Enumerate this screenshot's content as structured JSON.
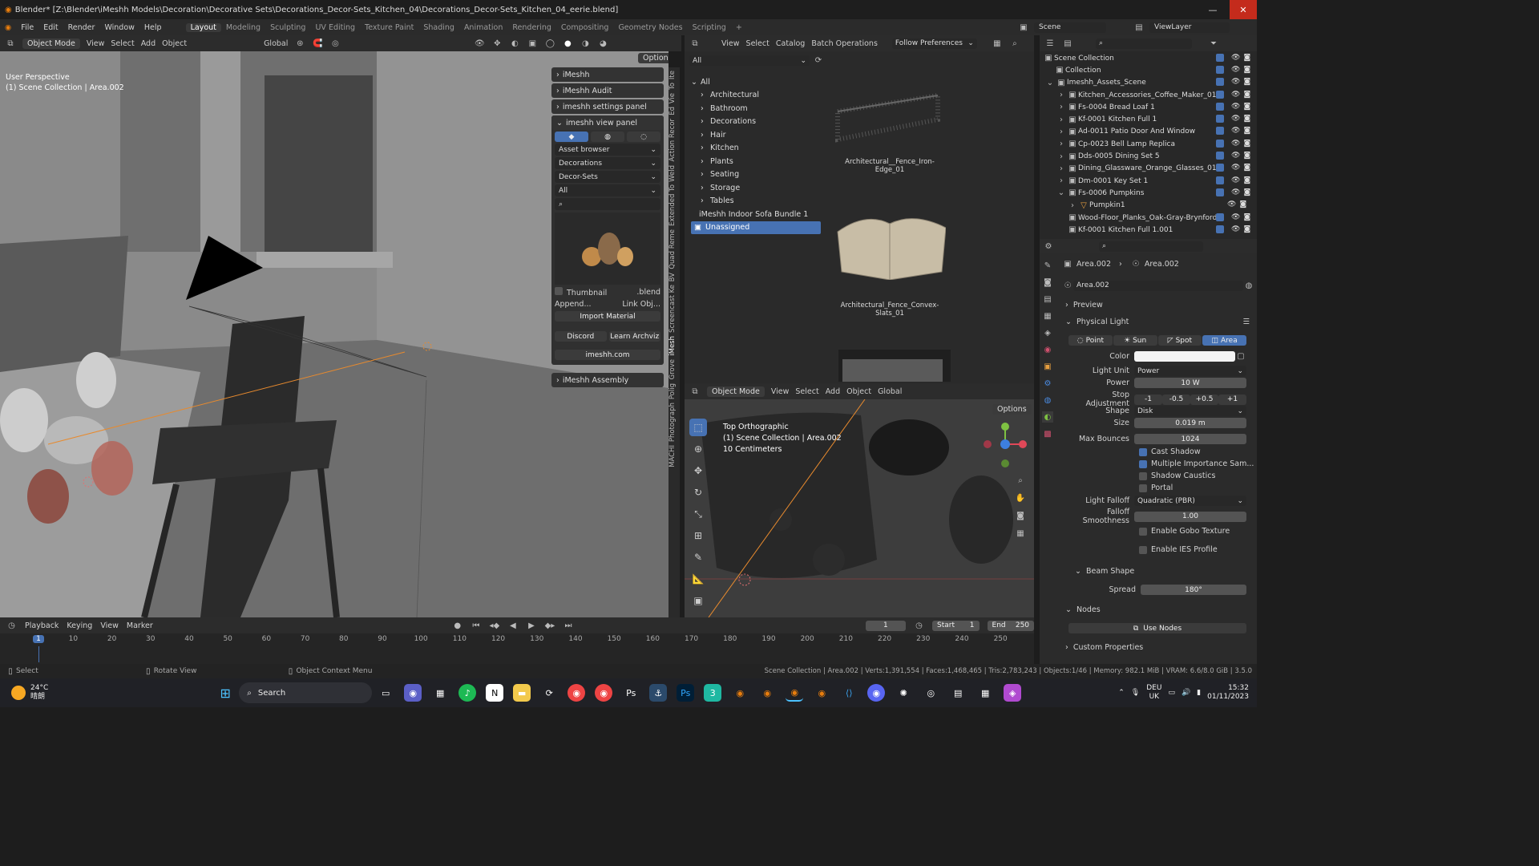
{
  "window": {
    "title": "Blender* [Z:\\Blender\\iMeshh Models\\Decoration\\Decorative Sets\\Decorations_Decor-Sets_Kitchen_04\\Decorations_Decor-Sets_Kitchen_04_eerie.blend]"
  },
  "menu": {
    "items": [
      "File",
      "Edit",
      "Render",
      "Window",
      "Help"
    ],
    "workspaces": [
      "Layout",
      "Modeling",
      "Sculpting",
      "UV Editing",
      "Texture Paint",
      "Shading",
      "Animation",
      "Rendering",
      "Compositing",
      "Geometry Nodes",
      "Scripting"
    ],
    "plus": "+",
    "scene": "Scene",
    "viewlayer": "ViewLayer"
  },
  "viewport": {
    "mode": "Object Mode",
    "menus": [
      "View",
      "Select",
      "Add",
      "Object"
    ],
    "orientation": "Global",
    "options": "Options",
    "overlay_title": "User Perspective",
    "overlay_sub": "(1) Scene Collection | Area.002"
  },
  "npanel": {
    "panels": [
      "iMeshh",
      "iMeshh Audit",
      "imeshh settings panel",
      "imeshh view panel"
    ],
    "selects": [
      "Asset browser",
      "Decorations",
      "Decor-Sets",
      "All"
    ],
    "thumbnail": "Thumbnail",
    "blend": ".blend",
    "append": "Append...",
    "link": "Link Obj...",
    "import": "Import Material",
    "discord": "Discord",
    "learn": "Learn Archviz",
    "site": "imeshh.com",
    "assembly": "iMeshh Assembly"
  },
  "sidetabs": [
    "Ite",
    "To",
    "Vie",
    "Ed",
    "Action Recor",
    "Weld",
    "Extended To",
    "Quad Reme",
    "BV",
    "Screencast Ke",
    "iMesh",
    "Grove",
    "Polig",
    "Photograph",
    "MACHI"
  ],
  "asset_browser": {
    "menus": [
      "View",
      "Select",
      "Catalog",
      "Batch Operations"
    ],
    "pref": "Follow Preferences",
    "filter": "All",
    "tree": [
      "All",
      "Architectural",
      "Bathroom",
      "Decorations",
      "Hair",
      "Kitchen",
      "Plants",
      "Seating",
      "Storage",
      "Tables",
      "iMeshh Indoor Sofa Bundle 1",
      "Unassigned"
    ],
    "assets": [
      "Architectural__Fence_Iron-Edge_01",
      "Architectural_Fence_Convex-Slats_01"
    ]
  },
  "viewport2": {
    "mode": "Object Mode",
    "menus": [
      "View",
      "Select",
      "Add",
      "Object"
    ],
    "orientation": "Global",
    "options": "Options",
    "title": "Top Orthographic",
    "sub": "(1) Scene Collection | Area.002",
    "scale": "10 Centimeters"
  },
  "outliner": {
    "rows": [
      "Scene Collection",
      "Collection",
      "Imeshh_Assets_Scene",
      "Kitchen_Accessories_Coffee_Maker_01",
      "Fs-0004 Bread Loaf 1",
      "Kf-0001 Kitchen Full 1",
      "Ad-0011 Patio Door And Window",
      "Cp-0023 Bell Lamp Replica",
      "Dds-0005 Dining Set 5",
      "Dining_Glassware_Orange_Glasses_01.0",
      "Dm-0001 Key Set 1",
      "Fs-0006 Pumpkins",
      "Pumpkin1",
      "Wood-Floor_Planks_Oak-Gray-Brynford_",
      "Kf-0001 Kitchen Full 1.001"
    ]
  },
  "props": {
    "crumb1": "Area.002",
    "crumb2": "Area.002",
    "name": "Area.002",
    "preview": "Preview",
    "physical": "Physical Light",
    "types": [
      "Point",
      "Sun",
      "Spot",
      "Area"
    ],
    "color_label": "Color",
    "unit_label": "Light Unit",
    "unit": "Power",
    "power_label": "Power",
    "power": "10 W",
    "stop_label": "Stop Adjustment",
    "stops": [
      "-1",
      "-0.5",
      "+0.5",
      "+1"
    ],
    "shape_label": "Shape",
    "shape": "Disk",
    "size_label": "Size",
    "size": "0.019 m",
    "bounces_label": "Max Bounces",
    "bounces": "1024",
    "checks": [
      "Cast Shadow",
      "Multiple Importance Sam...",
      "Shadow Caustics",
      "Portal"
    ],
    "falloff_label": "Light Falloff",
    "falloff": "Quadratic (PBR)",
    "smooth_label": "Falloff Smoothness",
    "smooth": "1.00",
    "gobo": "Enable Gobo Texture",
    "ies": "Enable IES Profile",
    "beam": "Beam Shape",
    "spread_label": "Spread",
    "spread": "180°",
    "nodes": "Nodes",
    "use_nodes": "Use Nodes",
    "custom": "Custom Properties"
  },
  "timeline": {
    "menus": [
      "Playback",
      "Keying",
      "View",
      "Marker"
    ],
    "frame": "1",
    "start_label": "Start",
    "start": "1",
    "end_label": "End",
    "end": "250",
    "ticks": [
      "1",
      "10",
      "20",
      "30",
      "40",
      "50",
      "60",
      "70",
      "80",
      "90",
      "100",
      "110",
      "120",
      "130",
      "140",
      "150",
      "160",
      "170",
      "180",
      "190",
      "200",
      "210",
      "220",
      "230",
      "240",
      "250"
    ]
  },
  "status": {
    "select": "Select",
    "rotate": "Rotate View",
    "ctx": "Object Context Menu",
    "info": "Scene Collection | Area.002 | Verts:1,391,554 | Faces:1,468,465 | Tris:2,783,243 | Objects:1/46 | Memory: 982.1 MiB | VRAM: 6.6/8.0 GiB | 3.5.0"
  },
  "taskbar": {
    "temp": "24°C",
    "weather": "晴朗",
    "search": "Search",
    "lang1": "DEU",
    "lang2": "UK",
    "time": "15:32",
    "date": "01/11/2023"
  }
}
